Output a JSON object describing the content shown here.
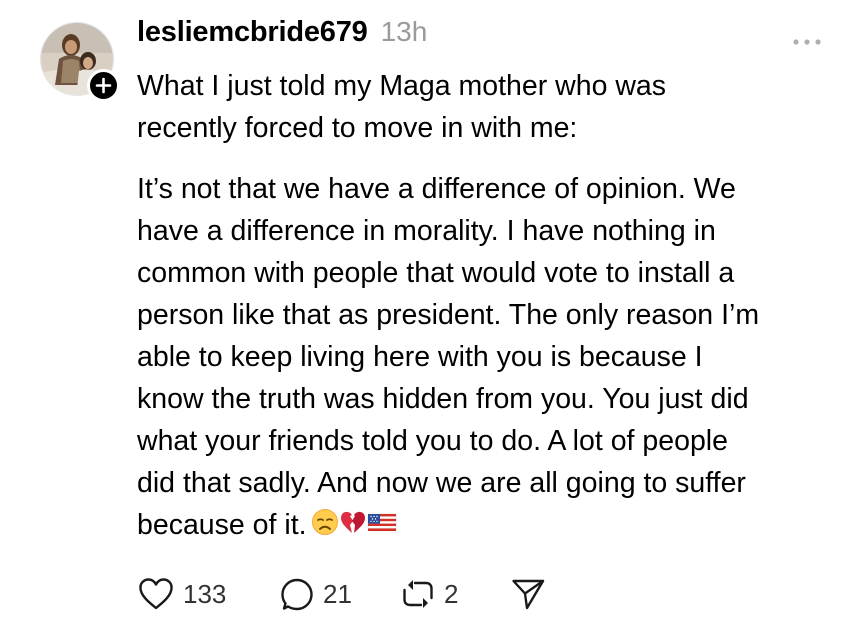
{
  "post": {
    "username": "lesliemcbride679",
    "timestamp": "13h",
    "paragraphs": [
      "What I just told my Maga mother who was\nrecently forced to move in with me:",
      "It’s not that we have a difference of opinion. We\nhave a difference in morality. I have nothing in\ncommon with people that would vote to install a\nperson like that as president. The only reason I’m\nable to keep living here with you is because I\nknow the truth was hidden from you. You just did\nwhat your friends told you to do. A lot of people\ndid that sadly. And now we are all going to suffer\nbecause of it."
    ],
    "emojis": [
      "disappointed-face",
      "broken-heart",
      "us-flag"
    ]
  },
  "actions": {
    "likes": "133",
    "replies": "21",
    "reposts": "2"
  },
  "icons": {
    "like": "heart-icon",
    "reply": "speech-bubble-icon",
    "repost": "repost-icon",
    "share": "send-icon",
    "more": "more-dots-icon",
    "follow": "plus-icon"
  },
  "colors": {
    "text": "#000000",
    "muted": "#9a9a9a",
    "count": "#333333"
  }
}
